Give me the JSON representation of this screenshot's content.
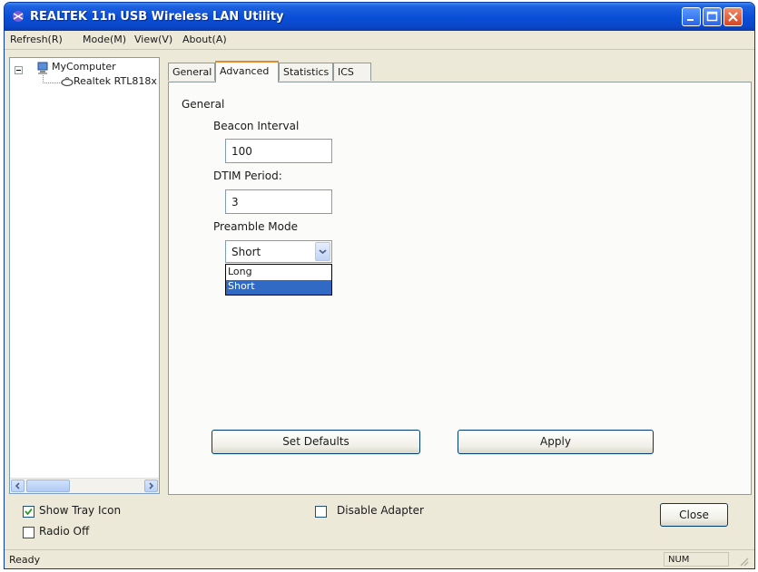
{
  "window": {
    "title": "REALTEK 11n USB Wireless LAN Utility"
  },
  "menu": [
    {
      "label": "Refresh(R)"
    },
    {
      "label": "Mode(M)"
    },
    {
      "label": "View(V)"
    },
    {
      "label": "About(A)"
    }
  ],
  "tree": {
    "root": "MyComputer",
    "child": "Realtek RTL818x"
  },
  "tabs": [
    {
      "label": "General"
    },
    {
      "label": "Advanced",
      "selected": true
    },
    {
      "label": "Statistics"
    },
    {
      "label": "ICS"
    }
  ],
  "advanced": {
    "group_label": "General",
    "beacon_label": "Beacon Interval",
    "beacon_value": "100",
    "dtim_label": "DTIM Period:",
    "dtim_value": "3",
    "preamble_label": "Preamble Mode",
    "preamble_value": "Short",
    "preamble_options": [
      "Long",
      "Short"
    ],
    "set_defaults": "Set Defaults",
    "apply": "Apply"
  },
  "bottom": {
    "show_tray_icon": {
      "label": "Show Tray Icon",
      "checked": true
    },
    "radio_off": {
      "label": "Radio Off",
      "checked": false
    },
    "disable_adapter": {
      "label": "Disable Adapter",
      "checked": false
    },
    "close": "Close"
  },
  "status": {
    "text": "Ready",
    "indicator": "NUM"
  },
  "colors": {
    "titlebar": "#0a4fd8",
    "selection": "#316ac5",
    "tab_accent": "#e68b2c",
    "window_bg": "#ece9d8"
  }
}
